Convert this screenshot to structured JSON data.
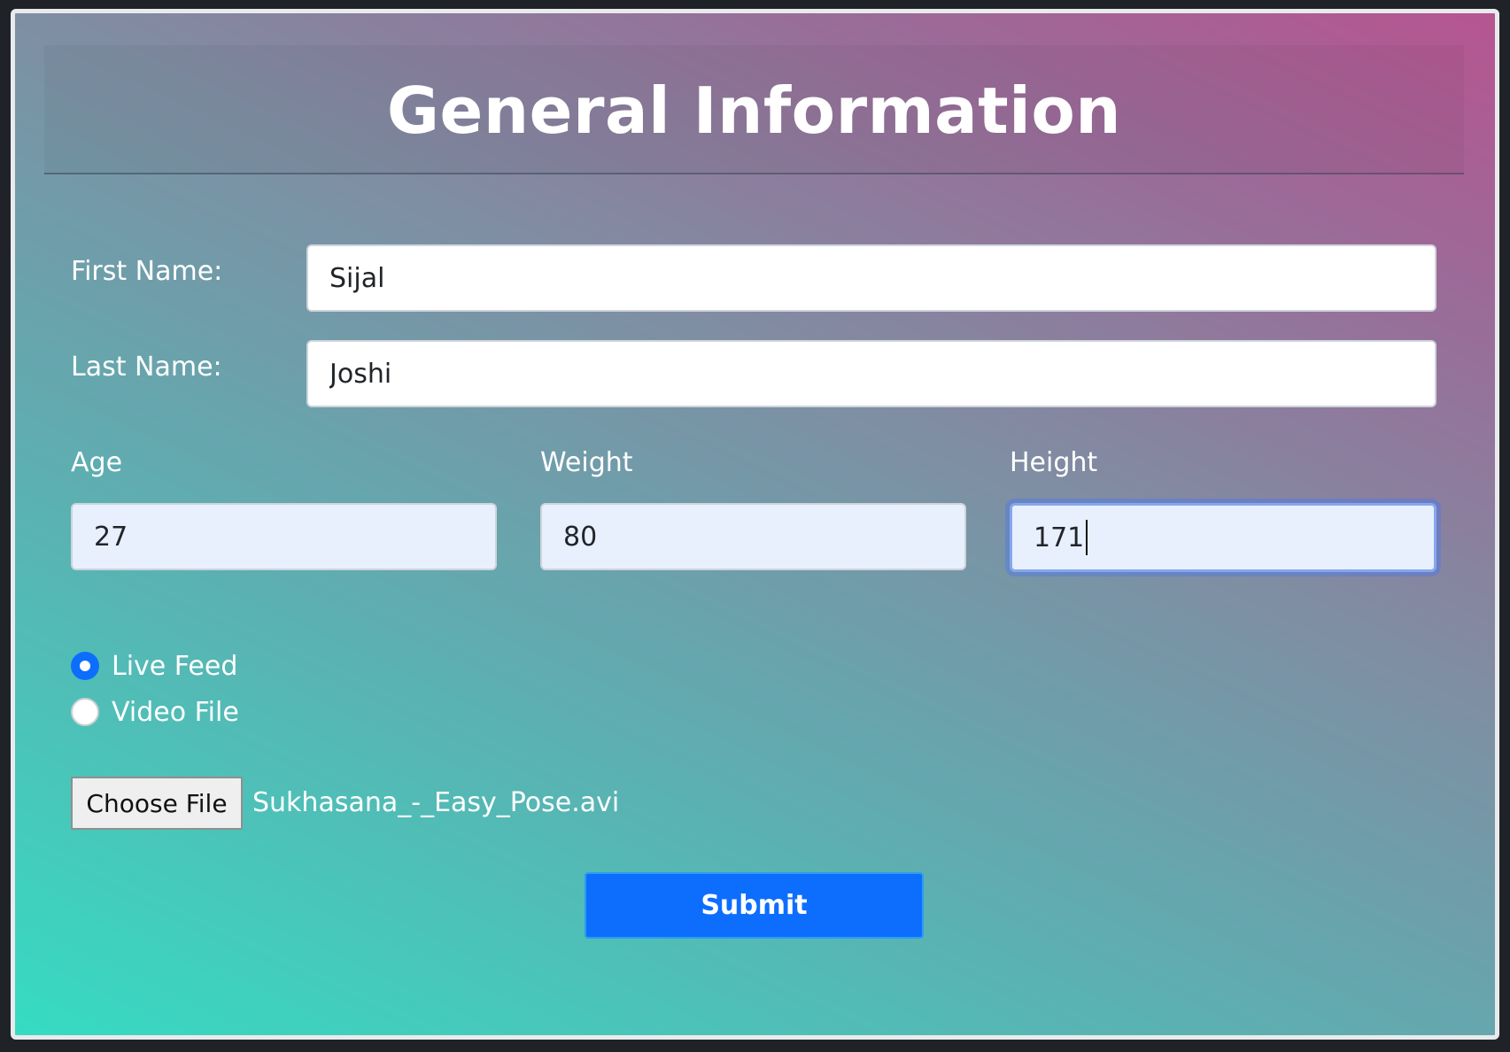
{
  "header": {
    "title": "General Information"
  },
  "form": {
    "first_name": {
      "label": "First Name:",
      "value": "Sijal"
    },
    "last_name": {
      "label": "Last Name:",
      "value": "Joshi"
    },
    "age": {
      "label": "Age",
      "value": "27"
    },
    "weight": {
      "label": "Weight",
      "value": "80"
    },
    "height": {
      "label": "Height",
      "value": "171"
    },
    "source_options": [
      {
        "label": "Live Feed",
        "checked": true
      },
      {
        "label": "Video File",
        "checked": false
      }
    ],
    "file": {
      "button_label": "Choose File",
      "file_name": "Sukhasana_-_Easy_Pose.avi"
    },
    "submit_label": "Submit"
  },
  "colors": {
    "primary": "#0d6efd",
    "gradient_start": "#36dbc2",
    "gradient_end": "#b65591",
    "input_autofill_bg": "#e8f0fe"
  },
  "icons": {
    "radio_checked": "radio-checked-icon",
    "radio_unchecked": "radio-unchecked-icon"
  }
}
